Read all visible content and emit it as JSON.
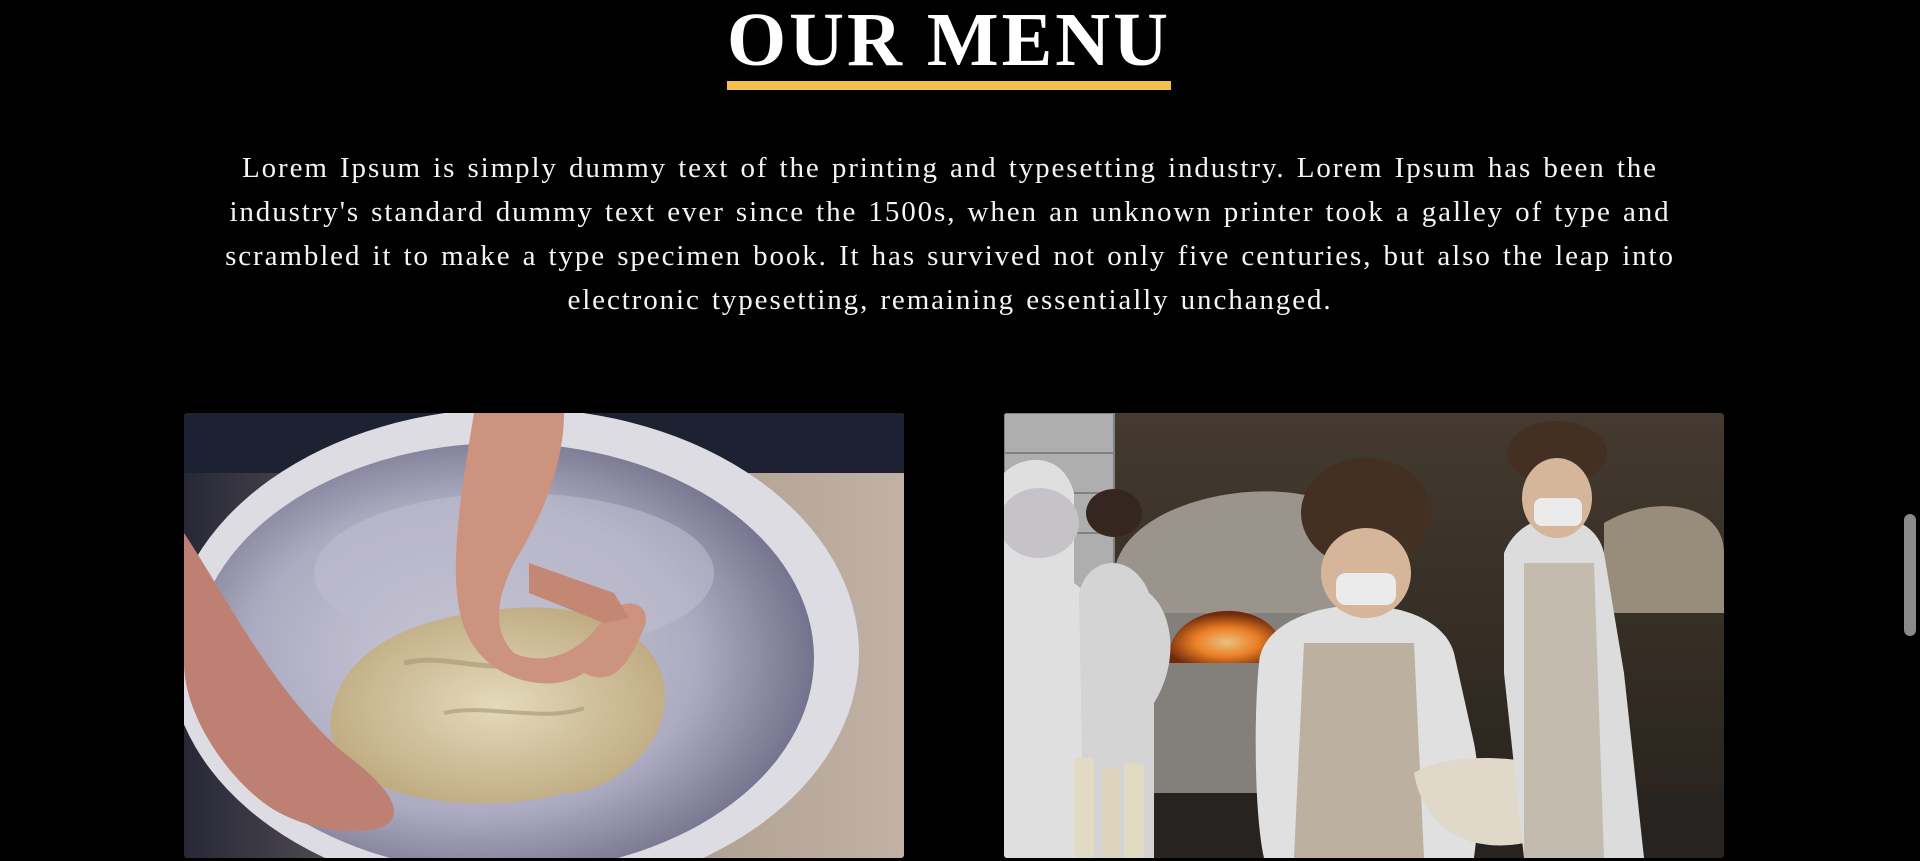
{
  "section": {
    "title": "OUR MENU",
    "intro_text": "Lorem Ipsum is simply dummy text of the printing and typesetting industry. Lorem Ipsum has been the industry's standard dummy text ever since the 1500s, when an unknown printer took a galley of type and scrambled it to make a type specimen book. It has survived not only five centuries, but also the leap into electronic typesetting, remaining essentially unchanged."
  },
  "gallery": [
    {
      "alt": "Hands kneading dough in a bowl"
    },
    {
      "alt": "Bakers in masks and aprons stretching dough in front of a wood-fired oven"
    }
  ],
  "colors": {
    "background": "#000000",
    "accent": "#f2c14e",
    "text": "#ffffff"
  }
}
